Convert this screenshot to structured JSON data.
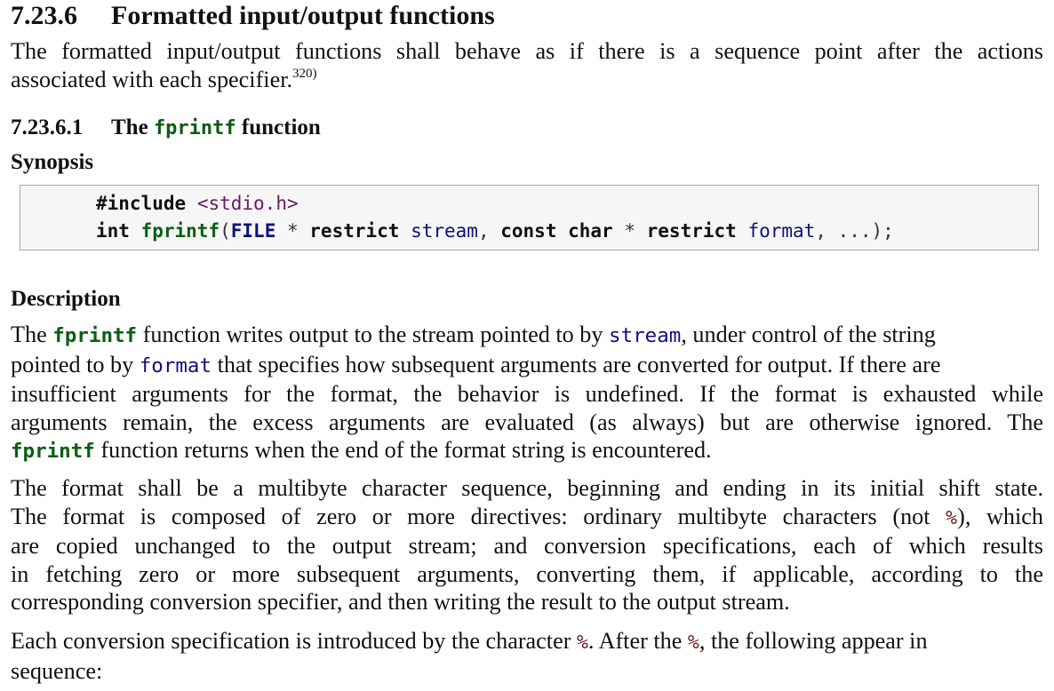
{
  "section": {
    "number": "7.23.6",
    "title": "Formatted input/output functions",
    "intro": {
      "text": "The formatted input/output functions shall behave as if there is a sequence point after the actions associated with each specifier.",
      "line1": "The formatted input/output functions shall behave as if there is a sequence point after the actions",
      "line2": "associated with each specifier.",
      "footnote_ref": "320)"
    }
  },
  "subsection": {
    "number": "7.23.6.1",
    "title_prefix": "The",
    "title_code": "fprintf",
    "title_suffix": "function"
  },
  "synopsis": {
    "heading": "Synopsis",
    "code": {
      "line1": {
        "directive": "#include",
        "header": "<stdio.h>"
      },
      "line2": {
        "ret_type": "int",
        "func_name": "fprintf",
        "open_paren": "(",
        "param1_type": "FILE",
        "star1": " * ",
        "restrict1": "restrict",
        "param1_name": "stream",
        "comma1": ", ",
        "const_kw": "const",
        "char_kw": "char",
        "star2": " * ",
        "restrict2": "restrict",
        "param2_name": "format",
        "rest": ", ...);"
      }
    }
  },
  "description": {
    "heading": "Description",
    "p1": {
      "l1_a": "The",
      "l1_code": "fprintf",
      "l1_b": "function writes output to the stream pointed to by",
      "l1_code2": "stream",
      "l1_c": ", under control of the string",
      "l2_a": "pointed to by",
      "l2_code": "format",
      "l2_b": "that specifies how subsequent arguments are converted for output. If there are",
      "l3": "insufficient arguments for the format, the behavior is undefined. If the format is exhausted while",
      "l4": "arguments remain, the excess arguments are evaluated (as always) but are otherwise ignored. The",
      "l5_code": "fprintf",
      "l5_b": "function returns when the end of the format string is encountered."
    },
    "p2": {
      "l1": "The format shall be a multibyte character sequence, beginning and ending in its initial shift state.",
      "l2_a": "The format is composed of zero or more directives: ordinary multibyte characters (not",
      "l2_pct": "%",
      "l2_b": "), which",
      "l3": "are copied unchanged to the output stream; and conversion specifications, each of which results",
      "l4": "in fetching zero or more subsequent arguments, converting them, if applicable, according to the",
      "l5": "corresponding conversion specifier, and then writing the result to the output stream."
    },
    "p3": {
      "l1_a": "Each conversion specification is introduced by the character",
      "l1_pct": "%",
      "l1_b": ". After the",
      "l1_pct2": "%",
      "l1_c": ", the following appear in",
      "l2": "sequence:"
    }
  },
  "colors": {
    "code_function": "#0b5e12",
    "code_identifier": "#10107a",
    "code_header": "#6a1a5e",
    "percent_char": "#6a1c1c",
    "codebox_bg": "#f6f6f6",
    "codebox_border": "#a8a8a8"
  }
}
